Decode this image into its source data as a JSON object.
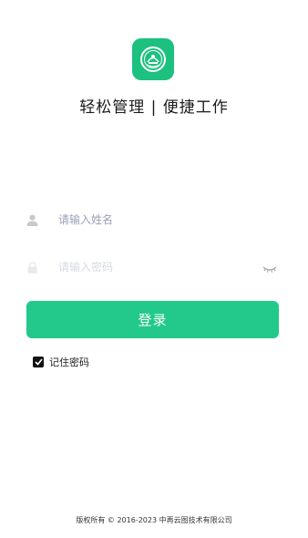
{
  "app": {
    "tagline": "轻松管理 | 便捷工作",
    "logo_icon": "emblem-icon",
    "brand_color": "#1cc07f"
  },
  "form": {
    "username_placeholder": "请输入姓名",
    "username_value": "",
    "password_placeholder": "请输入密码",
    "password_value": "",
    "user_icon": "user-icon",
    "lock_icon": "lock-icon",
    "eye_icon": "eye-closed-icon",
    "login_label": "登录",
    "login_color": "#22c98a",
    "remember_label": "记住密码",
    "remember_checked": true
  },
  "footer": {
    "copyright": "版权所有 © 2016-2023 中再云图技术有限公司"
  }
}
